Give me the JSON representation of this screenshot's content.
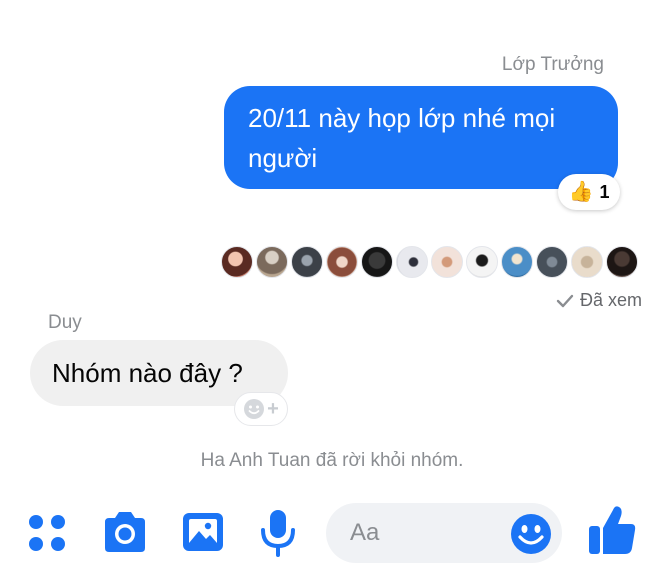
{
  "thread": {
    "outgoing_sender": "Lớp Trưởng",
    "outgoing_message": "20/11 này họp lớp nhé mọi người",
    "reaction": {
      "emoji": "👍",
      "count": "1"
    },
    "seen_by_count": 12,
    "seen_status": "Đã xem",
    "incoming_sender": "Duy",
    "incoming_message": "Nhóm nào đây ?",
    "add_reaction_plus": "+",
    "system_message": "Ha Anh Tuan đã rời khỏi nhóm."
  },
  "composer": {
    "placeholder": "Aa",
    "value": ""
  },
  "toolbar": {
    "icons": [
      "menu-dots-icon",
      "camera-icon",
      "gallery-icon",
      "microphone-icon",
      "emoji-icon",
      "like-thumb-icon"
    ],
    "accent_color": "#1b74f5"
  },
  "colors": {
    "outgoing_bubble": "#1b74f5",
    "incoming_bubble": "#f0f0f0",
    "secondary_text": "#8a8d91"
  }
}
